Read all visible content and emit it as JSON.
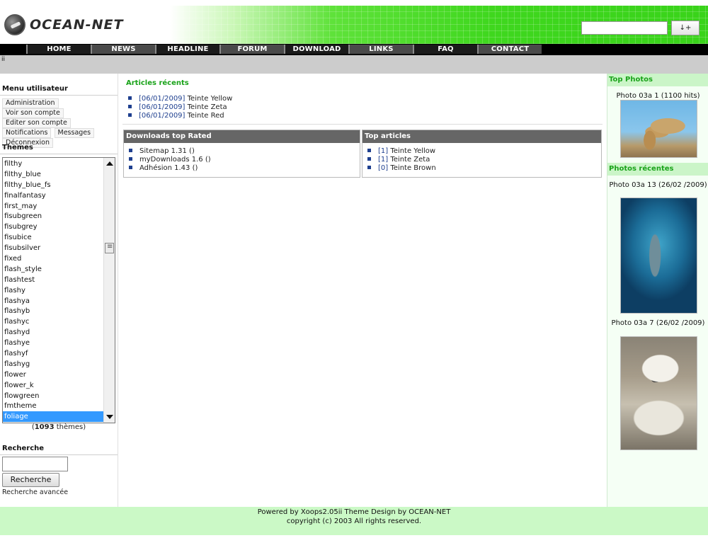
{
  "header": {
    "logo_text": "OCEAN-NET",
    "search_button_label": "↓+",
    "accent_color": "#39d31a"
  },
  "nav": {
    "items": [
      "HOME",
      "NEWS",
      "HEADLINE",
      "FORUM",
      "DOWNLOAD",
      "LINKS",
      "FAQ",
      "CONTACT"
    ]
  },
  "subbar": {
    "text": "ii"
  },
  "user_menu": {
    "title": "Menu utilisateur",
    "links": [
      "Administration",
      "Voir son compte",
      "Editer son compte",
      "Notifications",
      "Messages",
      "Déconnexion"
    ]
  },
  "themes": {
    "title": "Themes",
    "items": [
      "filthy",
      "filthy_blue",
      "filthy_blue_fs",
      "finalfantasy",
      "first_may",
      "fisubgreen",
      "fisubgrey",
      "fisubice",
      "fisubsilver",
      "fixed",
      "flash_style",
      "flashtest",
      "flashy",
      "flashya",
      "flashyb",
      "flashyc",
      "flashyd",
      "flashye",
      "flashyf",
      "flashyg",
      "flower",
      "flower_k",
      "flowgreen",
      "fmtheme",
      "foliage"
    ],
    "selected": "foliage",
    "count_prefix": "(",
    "count": "1093",
    "count_suffix": " thèmes)"
  },
  "search": {
    "title": "Recherche",
    "button_label": "Recherche",
    "advanced_label": "Recherche avancée"
  },
  "recent_articles": {
    "title": "Articles récents",
    "items": [
      {
        "date": "[06/01/2009]",
        "title": "Teinte Yellow"
      },
      {
        "date": "[06/01/2009]",
        "title": "Teinte Zeta"
      },
      {
        "date": "[06/01/2009]",
        "title": "Teinte Red"
      }
    ]
  },
  "downloads_top": {
    "title": "Downloads top Rated",
    "items": [
      "Sitemap 1.31 ()",
      "myDownloads 1.6 ()",
      "Adhésion 1.43 ()"
    ]
  },
  "top_articles": {
    "title": "Top articles",
    "items": [
      {
        "count": "[1]",
        "title": "Teinte Yellow"
      },
      {
        "count": "[1]",
        "title": "Teinte Zeta"
      },
      {
        "count": "[0]",
        "title": "Teinte Brown"
      }
    ]
  },
  "right": {
    "top_photos_title": "Top Photos",
    "top_photo_caption": "Photo 03a 1 (1100 hits)",
    "recent_photos_title": "Photos récentes",
    "recent_photo_1_caption": "Photo 03a 13 (26/02 /2009)",
    "recent_photo_2_caption": "Photo 03a 7 (26/02 /2009)"
  },
  "footer": {
    "line1": "Powered by Xoops2.05ii Theme Design by OCEAN-NET",
    "line2": "copyright (c) 2003 All rights reserved."
  }
}
